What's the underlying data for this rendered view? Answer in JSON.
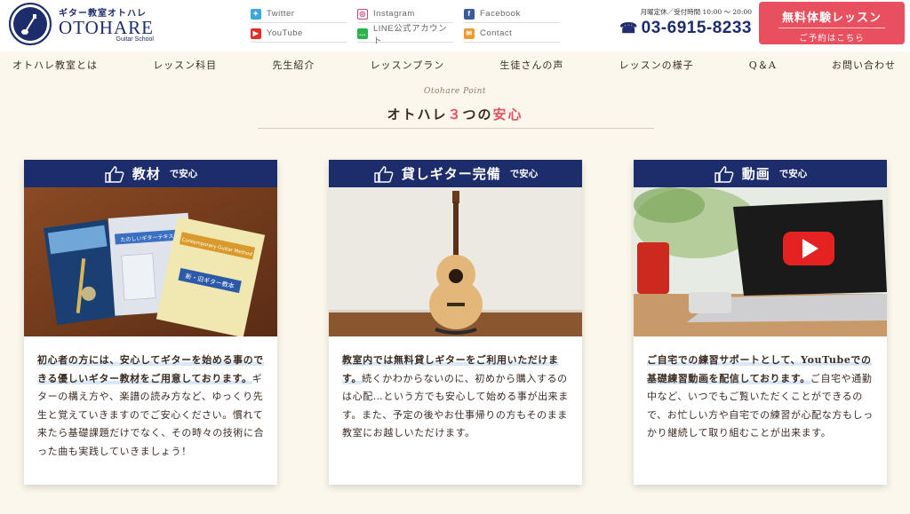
{
  "header": {
    "logo_seal_text": "GUITAR SCHOOL OTOHARE",
    "logo_sub": "ギター教室オトハレ",
    "logo_main": "OTOHARE",
    "logo_eng": "Guitar School",
    "sns": [
      {
        "label": "Twitter",
        "icon": "twitter-icon",
        "color": "#3aa6e0"
      },
      {
        "label": "Instagram",
        "icon": "instagram-icon",
        "color": "#c8467e"
      },
      {
        "label": "Facebook",
        "icon": "facebook-icon",
        "color": "#3b5a9a"
      },
      {
        "label": "YouTube",
        "icon": "youtube-icon",
        "color": "#e52d27"
      },
      {
        "label": "LINE公式アカウント",
        "icon": "line-icon",
        "color": "#2bb24a"
      },
      {
        "label": "Contact",
        "icon": "mail-icon",
        "color": "#f29a2e"
      }
    ],
    "hours": "月曜定休／受付時間 10:00 ～ 20:00",
    "phone": "03-6915-8233",
    "trial_title": "無料体験レッスン",
    "trial_sub": "ご予約はこちら"
  },
  "nav": [
    "オトハレ教室とは",
    "レッスン科目",
    "先生紹介",
    "レッスンプラン",
    "生徒さんの声",
    "レッスンの様子",
    "Q＆A",
    "お問い合わせ"
  ],
  "section": {
    "script": "Otohare Point",
    "title_pre": "オトハレ",
    "title_num": "３",
    "title_mid": "つの",
    "title_red": "安心"
  },
  "cards": [
    {
      "title": "教材",
      "suffix": "で安心",
      "text_em": "初心者の方には、安心してギターを始める事のできる優しいギター教材をご用意しております。",
      "text": "ギターの構え方や、楽譜の読み方など、ゆっくり先生と覚えていきますのでご安心ください。慣れて来たら基礎課題だけでなく、その時々の技術に合った曲も実践していきましょう！"
    },
    {
      "title": "貸しギター完備",
      "suffix": "で安心",
      "text_em": "教室内では無料貸しギターをご利用いただけます。",
      "text": "続くかわからないのに、初めから購入するのは心配…という方でも安心して始める事が出来ます。また、予定の後やお仕事帰りの方もそのまま教室にお越しいただけます。"
    },
    {
      "title": "動画",
      "suffix": "で安心",
      "text_em": "ご自宅での練習サポートとして、YouTubeでの基礎練習動画を配信しております。",
      "text": "ご自宅や通勤中など、いつでもご覧いただくことができるので、お忙しい方や自宅での練習が心配な方もしっかり継続して取り組むことが出来ます。"
    }
  ],
  "book_titles": [
    "たのしいギターテキスト",
    "Contemporary Guitar Method",
    "新・旧ギター教本"
  ],
  "colors": {
    "navy": "#1d2c6b",
    "accent_red": "#e8505f",
    "background": "#fbf7ec"
  }
}
